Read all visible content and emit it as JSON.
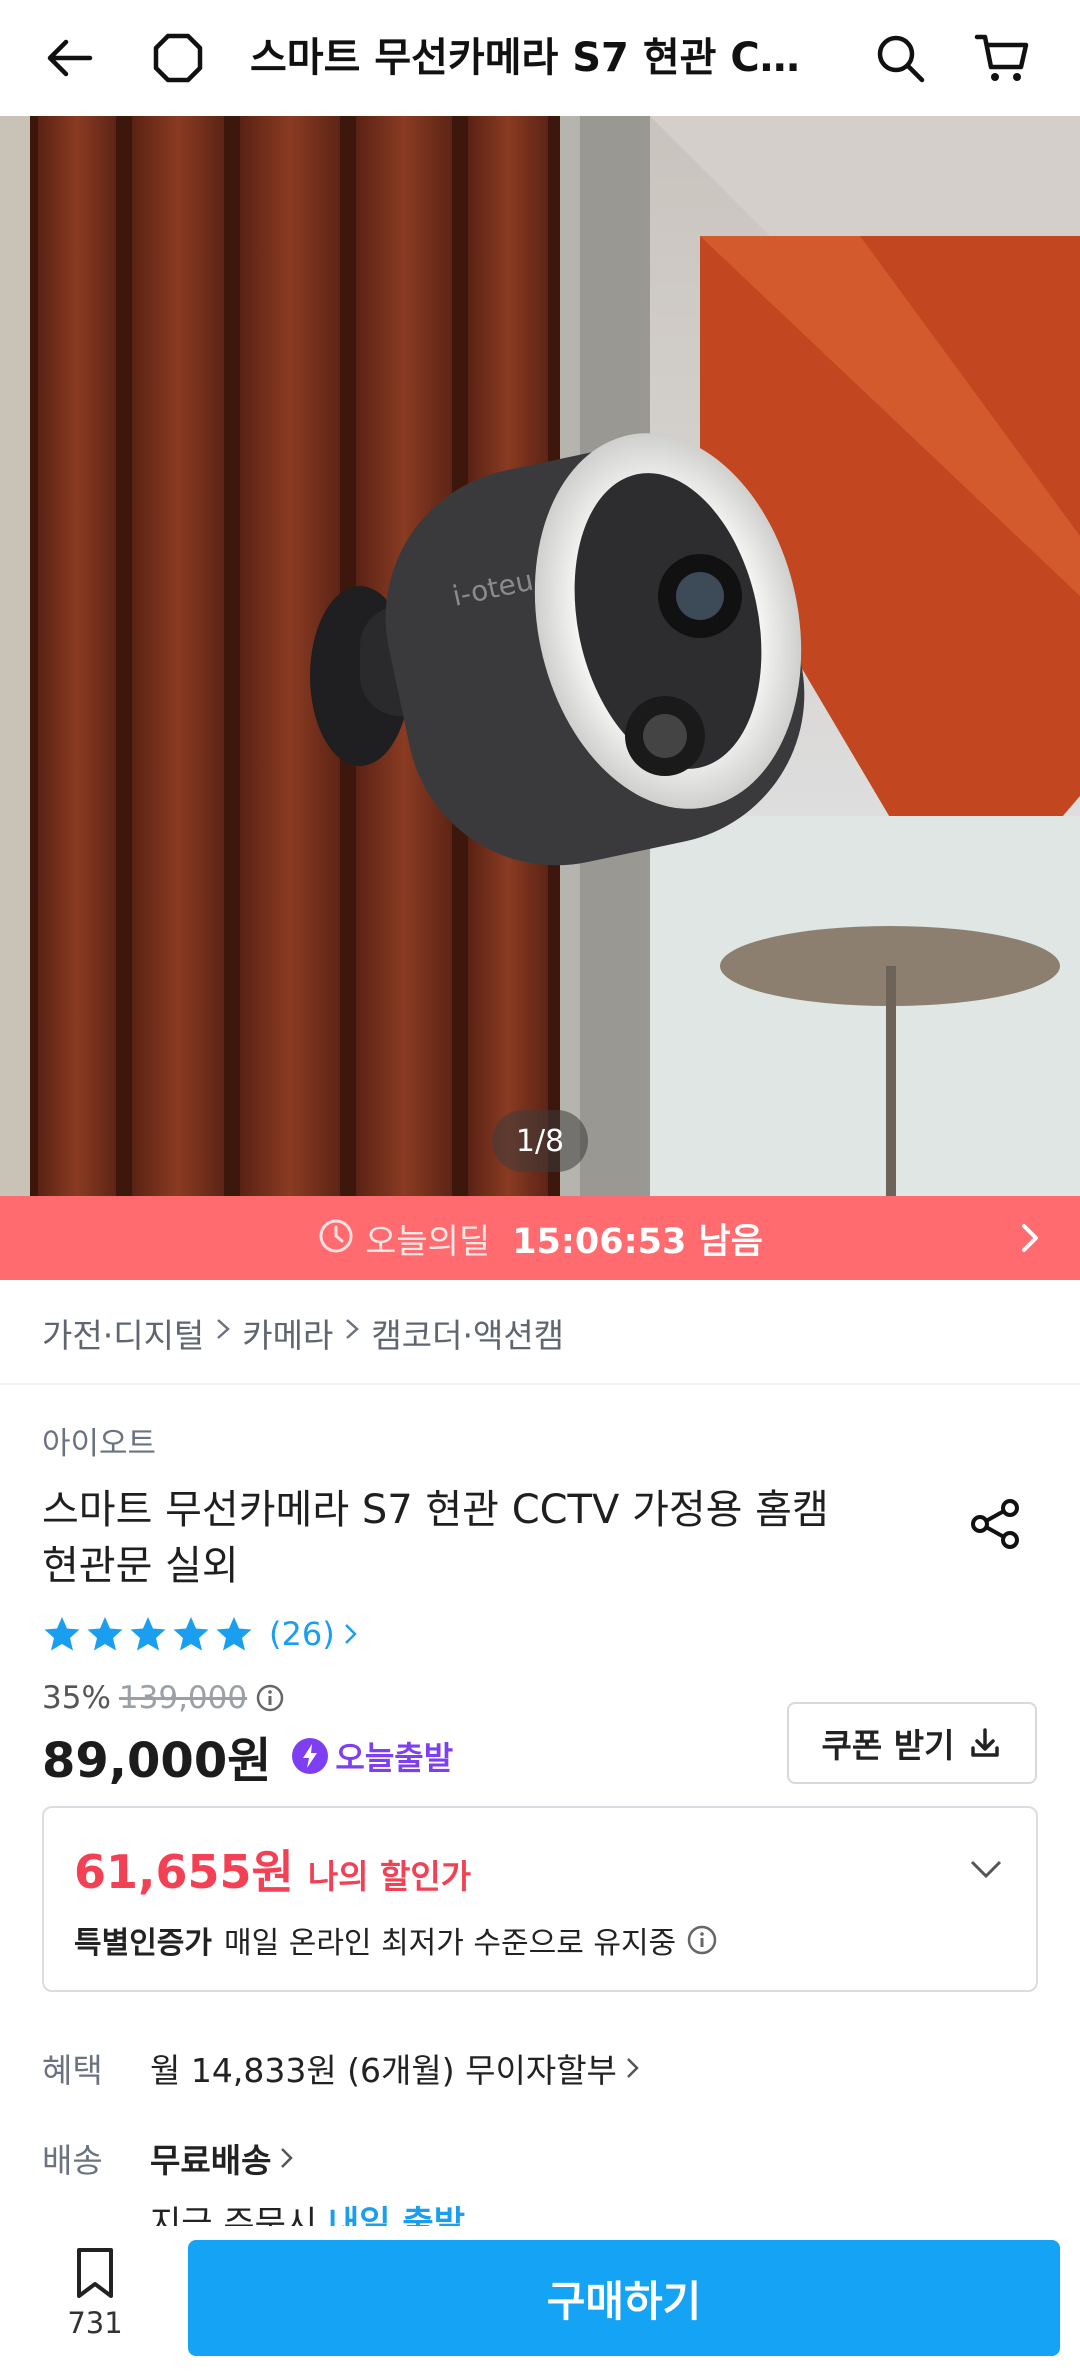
{
  "header": {
    "title": "스마트 무선카메라 S7 현관 C…",
    "icons": [
      "back-arrow-icon",
      "home-icon",
      "search-icon",
      "cart-icon"
    ]
  },
  "hero": {
    "counter": "1/8",
    "camera_brand_text": "i-oteu"
  },
  "deal": {
    "label": "오늘의딜",
    "time_left": "15:06:53 남음"
  },
  "breadcrumb": [
    "가전·디지털",
    "카메라",
    "캠코더·액션캠"
  ],
  "product": {
    "brand": "아이오트",
    "title_line1": "스마트 무선카메라 S7 현관 CCTV 가정용 홈캠",
    "title_line2": "현관문 실외",
    "rating_stars": 5,
    "review_count": "(26)",
    "discount": "35%",
    "original_price": "139,000",
    "price": "89,000원",
    "today_ship": "오늘출발",
    "coupon_label": "쿠폰 받기"
  },
  "my_price": {
    "value": "61,655원",
    "label": "나의 할인가",
    "cert_bold": "특별인증가",
    "cert_text": "매일 온라인 최저가 수준으로 유지중"
  },
  "benefit": {
    "label": "혜택",
    "value": "월 14,833원 (6개월) 무이자할부"
  },
  "shipping": {
    "label": "배송",
    "value": "무료배송",
    "note_prefix": "지금 주문시 ",
    "note_highlight": "내일 출발"
  },
  "bottom_bar": {
    "bookmark_count": "731",
    "buy_label": "구매하기"
  },
  "colors": {
    "deal_banner": "#ff6b6f",
    "accent_blue": "#14a3f5",
    "my_price_red": "#f24155",
    "today_purple": "#7e3ff2"
  }
}
